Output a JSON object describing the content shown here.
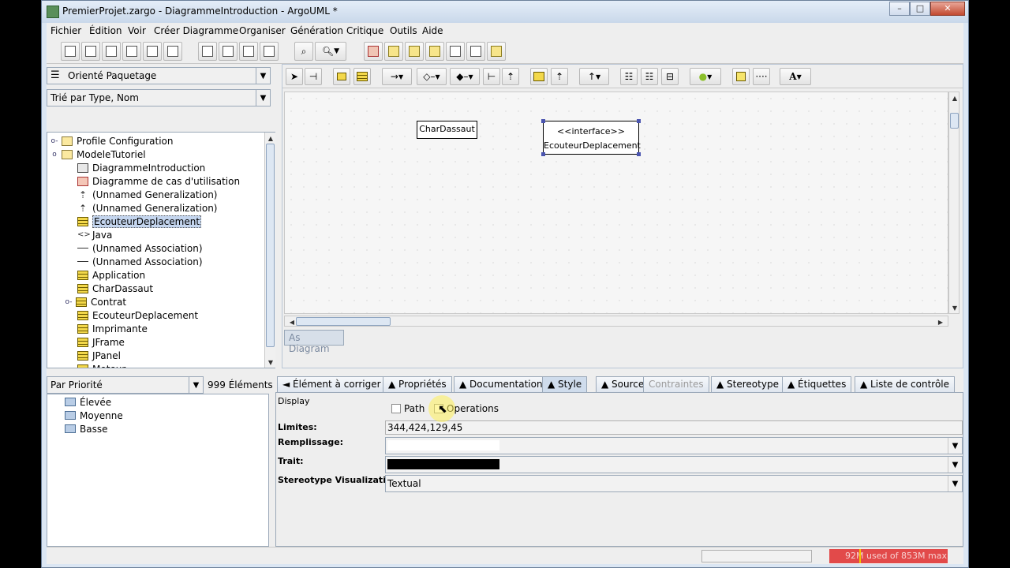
{
  "window": {
    "title": "PremierProjet.zargo - DiagrammeIntroduction - ArgoUML *",
    "controls": {
      "minimize": "–",
      "maximize": "□",
      "close": "✕"
    }
  },
  "menubar": [
    "Fichier",
    "Édition",
    "Voir",
    "Créer Diagramme",
    "Organiser",
    "Génération",
    "Critique",
    "Outils",
    "Aide"
  ],
  "explorer": {
    "perspective": "Orienté Paquetage",
    "ordering": "Trié par Type, Nom",
    "tree": [
      {
        "label": "Profile Configuration",
        "icon": "folder",
        "exp": "o-"
      },
      {
        "label": "ModeleTutoriel",
        "icon": "folder",
        "exp": "o"
      },
      {
        "label": "DiagrammeIntroduction",
        "icon": "diagram"
      },
      {
        "label": "Diagramme de cas d'utilisation",
        "icon": "diagram-red"
      },
      {
        "label": "(Unnamed Generalization)",
        "icon": "gen"
      },
      {
        "label": "(Unnamed Generalization)",
        "icon": "gen"
      },
      {
        "label": "EcouteurDeplacement",
        "icon": "class",
        "selected": true
      },
      {
        "label": "Java",
        "icon": "pkg"
      },
      {
        "label": "(Unnamed Association)",
        "icon": "assoc"
      },
      {
        "label": "(Unnamed Association)",
        "icon": "assoc"
      },
      {
        "label": "Application",
        "icon": "class"
      },
      {
        "label": "CharDassaut",
        "icon": "class"
      },
      {
        "label": "Contrat",
        "icon": "class",
        "exp": "o-"
      },
      {
        "label": "EcouteurDeplacement",
        "icon": "class"
      },
      {
        "label": "Imprimante",
        "icon": "class"
      },
      {
        "label": "JFrame",
        "icon": "class"
      },
      {
        "label": "JPanel",
        "icon": "class"
      },
      {
        "label": "Moteur",
        "icon": "class"
      }
    ]
  },
  "diagram": {
    "tab": "As Diagram",
    "class_box": {
      "name": "CharDassaut"
    },
    "interface_box": {
      "stereotype": "<<interface>>",
      "name": "EcouteurDeplacement"
    }
  },
  "todo": {
    "grouping": "Par Priorité",
    "count": "999 Éléments",
    "items": [
      "Élevée",
      "Moyenne",
      "Basse"
    ]
  },
  "details": {
    "tabs": [
      "◄ Élément à corriger",
      "▲ Propriétés",
      "▲ Documentation",
      "▲ Style",
      "▲ Source",
      "Contraintes",
      "▲ Stereotype",
      "▲ Étiquettes",
      "▲ Liste de contrôle"
    ],
    "active_tab": "▲ Style",
    "display_label": "Display",
    "path_label": "Path",
    "operations_label": "Operations",
    "limits_label": "Limites:",
    "limits_value": "344,424,129,45",
    "fill_label": "Remplissage:",
    "stroke_label": "Trait:",
    "stereo_vis_label": "Stereotype Visualization:",
    "stereo_vis_value": "Textual",
    "fill_color": "#ffffff",
    "stroke_color": "#000000"
  },
  "status": {
    "memory": "92M used of 853M max"
  }
}
